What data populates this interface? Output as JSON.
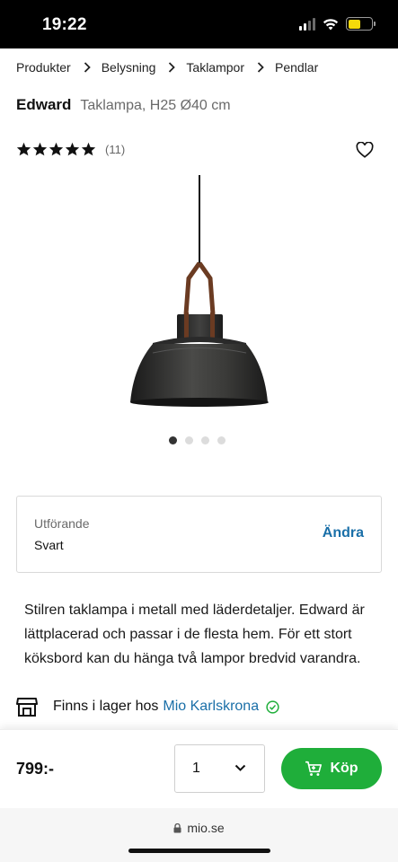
{
  "status_bar": {
    "time": "19:22"
  },
  "breadcrumb": [
    "Produkter",
    "Belysning",
    "Taklampor",
    "Pendlar"
  ],
  "product": {
    "name": "Edward",
    "subtitle": "Taklampa, H25 Ø40 cm",
    "rating_stars": 5,
    "review_count": "(11)"
  },
  "gallery": {
    "image_count": 4,
    "active_index": 0
  },
  "variant": {
    "label": "Utförande",
    "value": "Svart",
    "change_label": "Ändra"
  },
  "description": "Stilren taklampa i metall med läderdetaljer. Edward är lättplacerad och passar i de flesta hem. För ett stort köksbord kan du hänga två lampor bredvid varandra.",
  "stock": {
    "text": "Finns i lager hos",
    "store": "Mio Karlskrona"
  },
  "purchase": {
    "price": "799:-",
    "quantity": "1",
    "buy_label": "Köp"
  },
  "browser": {
    "url": "mio.se"
  },
  "colors": {
    "accent_blue": "#1a6fa8",
    "buy_green": "#1fae3a",
    "check_green": "#1fae3a"
  }
}
